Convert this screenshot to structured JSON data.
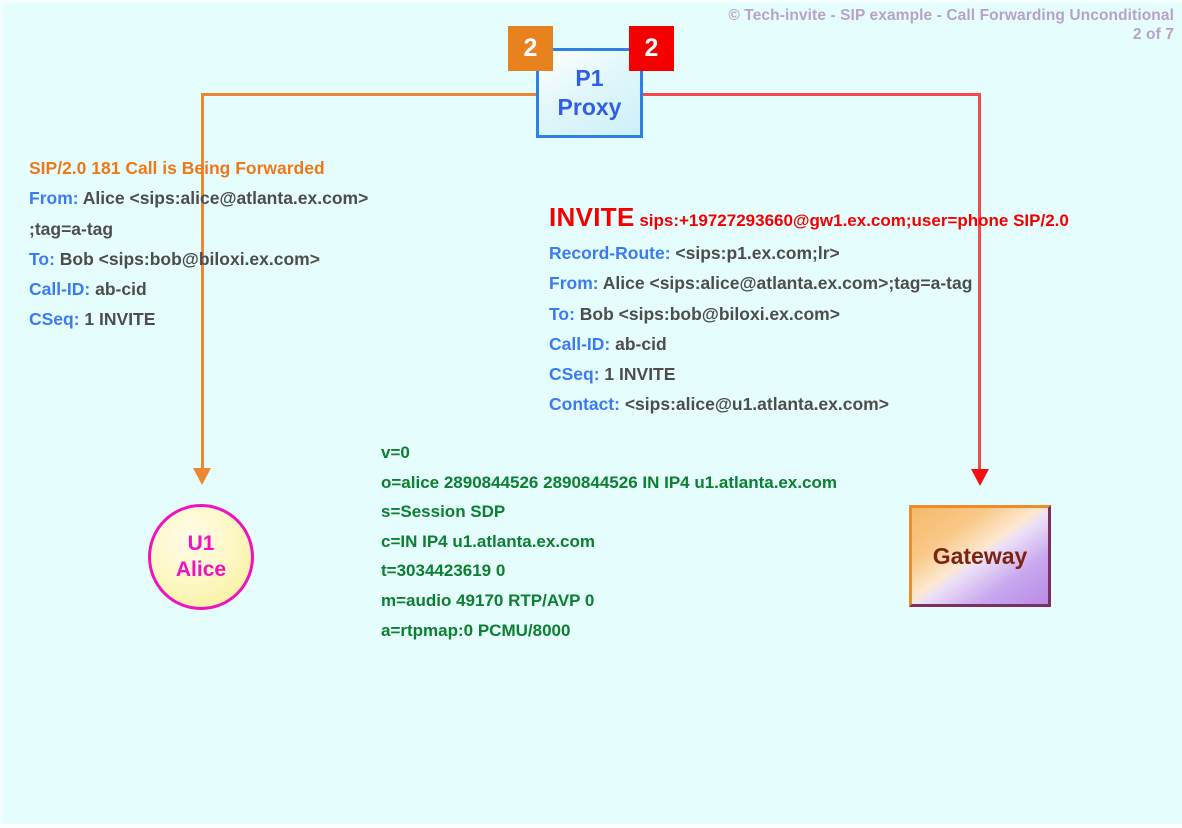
{
  "header": {
    "copyright_line": "© Tech-invite - SIP example - Call Forwarding Unconditional",
    "page_indicator": "2 of 7"
  },
  "nodes": {
    "proxy": {
      "name_line1": "P1",
      "name_line2": "Proxy",
      "badge_left": "2",
      "badge_right": "2"
    },
    "user_agent": {
      "line1": "U1",
      "line2": "Alice"
    },
    "gateway": {
      "label": "Gateway"
    }
  },
  "messages": {
    "response_181": {
      "start_line": "SIP/2.0 181 Call is Being Forwarded",
      "headers": [
        {
          "name": "From:",
          "value": " Alice <sips:alice@atlanta.ex.com>"
        },
        {
          "name": "",
          "value": " ;tag=a-tag"
        },
        {
          "name": "To:",
          "value": " Bob <sips:bob@biloxi.ex.com>"
        },
        {
          "name": "Call-ID:",
          "value": " ab-cid"
        },
        {
          "name": "CSeq:",
          "value": " 1 INVITE"
        }
      ]
    },
    "request_invite": {
      "method": "INVITE",
      "request_uri": "sips:+19727293660@gw1.ex.com;user=phone SIP/2.0",
      "headers": [
        {
          "name": "Record-Route:",
          "value": " <sips:p1.ex.com;lr>"
        },
        {
          "name": "From:",
          "value": " Alice <sips:alice@atlanta.ex.com>;tag=a-tag"
        },
        {
          "name": "To:",
          "value": " Bob <sips:bob@biloxi.ex.com>"
        },
        {
          "name": "Call-ID:",
          "value": " ab-cid"
        },
        {
          "name": "CSeq:",
          "value": " 1 INVITE"
        },
        {
          "name": "Contact:",
          "value": " <sips:alice@u1.atlanta.ex.com>"
        }
      ]
    },
    "sdp_body": {
      "lines": [
        "v=0",
        "o=alice  2890844526  2890844526  IN  IP4  u1.atlanta.ex.com",
        "s=Session SDP",
        "c=IN  IP4  u1.atlanta.ex.com",
        "t=3034423619  0",
        "m=audio  49170  RTP/AVP  0",
        "a=rtpmap:0  PCMU/8000"
      ]
    }
  },
  "colors": {
    "background": "#e6fdfd",
    "orange_flow": "#ed8733",
    "red_flow": "#f8484b",
    "proxy_blue": "#2f7fe8",
    "header_name_blue": "#3a7cf0",
    "sdp_green": "#0a8030",
    "alice_magenta": "#f012bf",
    "header_mauve": "#b9a2c9"
  }
}
